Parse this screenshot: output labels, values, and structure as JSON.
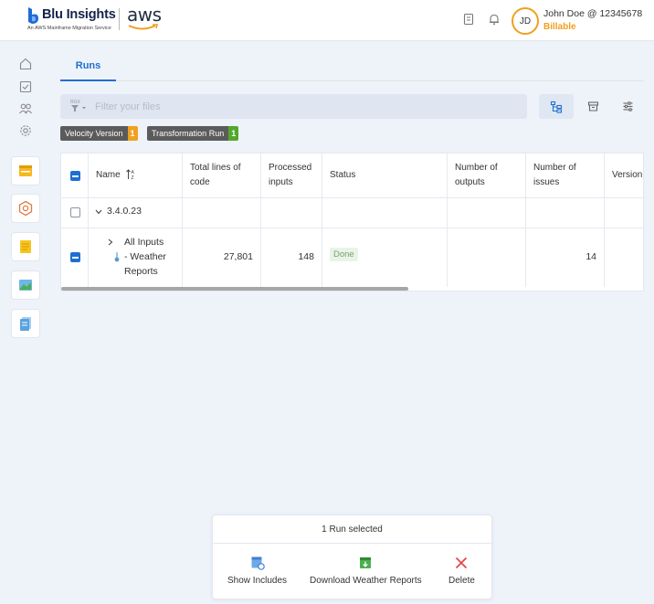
{
  "header": {
    "brand_title": "Blu Insights",
    "brand_subtitle": "An AWS Mainframe Migration Service",
    "partner_logo": "aws",
    "icons": [
      "book-icon",
      "bell-icon"
    ],
    "user_initials": "JD",
    "user_name": "John Doe @ 12345678",
    "user_status": "Billable",
    "colors": {
      "accent": "#f0a020",
      "brand": "#16234a"
    }
  },
  "sidebar": {
    "icons": [
      "home-icon",
      "checklist-icon",
      "users-icon",
      "gear-icon"
    ],
    "modules": [
      "codebase-module-icon",
      "transformation-center-icon",
      "notes-module-icon",
      "dashboard-module-icon",
      "documents-module-icon"
    ]
  },
  "tabs": [
    {
      "label": "Runs",
      "active": true
    }
  ],
  "filter": {
    "placeholder": "Filter your files",
    "value": ""
  },
  "toolbar": [
    "tree-view-icon",
    "archive-icon",
    "settings-sliders-icon"
  ],
  "badges": [
    {
      "label": "Velocity Version",
      "count": "1",
      "color": "#f0a020"
    },
    {
      "label": "Transformation Run",
      "count": "1",
      "color": "#52a82c"
    }
  ],
  "table": {
    "columns": {
      "name": "Name",
      "total_lines_1": "Total lines of",
      "total_lines_2": "code",
      "processed_1": "Processed",
      "processed_2": "inputs",
      "status": "Status",
      "outputs_1": "Number of",
      "outputs_2": "outputs",
      "issues_1": "Number of",
      "issues_2": "issues",
      "version": "Version"
    },
    "rows": [
      {
        "name": "3.4.0.23",
        "selected": false
      },
      {
        "name_1": "All Inputs",
        "name_2": "- Weather",
        "name_3": "Reports",
        "total_lines": "27,801",
        "processed": "148",
        "status": "Done",
        "outputs": "",
        "issues": "14",
        "selected": true
      }
    ]
  },
  "action_bar": {
    "title": "1 Run selected",
    "actions": [
      {
        "label": "Show Includes",
        "icon": "show-includes-icon"
      },
      {
        "label": "Download Weather Reports",
        "icon": "download-icon"
      },
      {
        "label": "Delete",
        "icon": "delete-x-icon"
      }
    ]
  }
}
